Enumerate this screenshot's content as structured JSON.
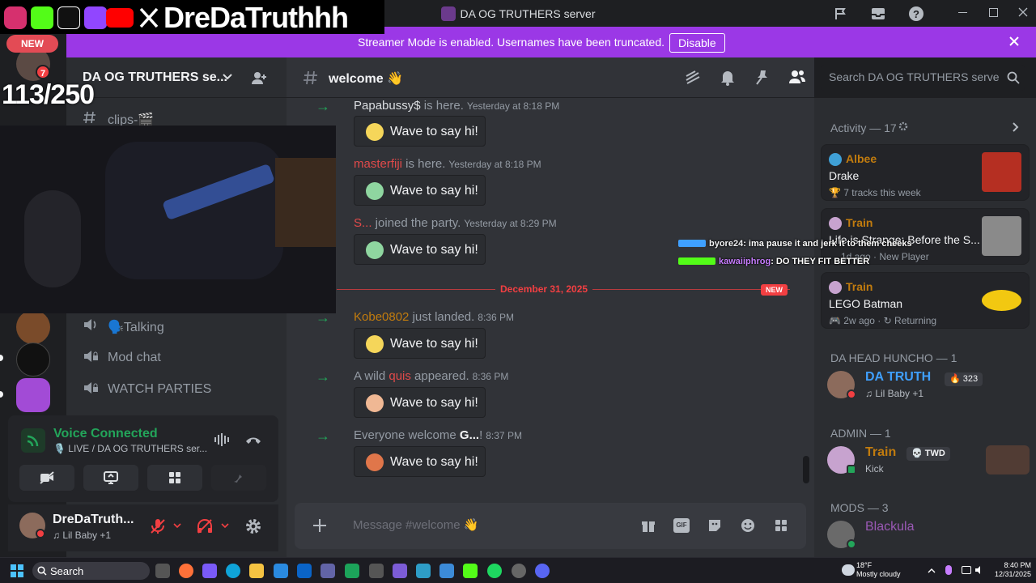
{
  "app": {
    "title": "DA OG TRUTHERS server"
  },
  "overlay": {
    "handle": "DreDaTruthhh",
    "new_badge": "NEW",
    "sub_count": "113/250",
    "rail_badge": "7"
  },
  "banner": {
    "text": "Streamer Mode is enabled. Usernames have been truncated.",
    "disable_label": "Disable"
  },
  "sidebar": {
    "server_name": "DA OG TRUTHERS se...",
    "channels": [
      {
        "label": "clips-🎬",
        "icon": "hash-icon"
      },
      {
        "label": "🗣️Talking",
        "icon": "speaker-icon"
      },
      {
        "label": "Mod chat",
        "icon": "lock-speaker-icon"
      },
      {
        "label": "WATCH PARTIES",
        "icon": "lock-speaker-icon"
      }
    ]
  },
  "voice": {
    "status": "Voice Connected",
    "detail": "🎙️ LIVE / DA OG TRUTHERS ser..."
  },
  "user": {
    "name": "DreDaTruth...",
    "status": "♫ Lil Baby +1"
  },
  "chat": {
    "channel": "welcome 👋",
    "search_placeholder": "Search DA OG TRUTHERS server",
    "composer_placeholder": "Message #welcome 👋",
    "wave_label": "Wave to say hi!",
    "date_divider": "December 31, 2025",
    "new_tag": "NEW",
    "messages": [
      {
        "name": "Papabussy$",
        "name_color": "#dbdee1",
        "text": " is here.",
        "time": "Yesterday at 8:18 PM"
      },
      {
        "name": "masterfiji",
        "name_color": "#e04a4a",
        "text": " is here.",
        "time": "Yesterday at 8:18 PM"
      },
      {
        "name": "S...",
        "name_color": "#e04a4a",
        "text": " joined the party.",
        "time": "Yesterday at 8:29 PM"
      },
      {
        "name": "Kobe0802",
        "name_color": "#c27c0e",
        "text": " just landed.",
        "time": "8:36 PM"
      },
      {
        "prefix": "A wild ",
        "name": "quis",
        "name_color": "#e04a4a",
        "text": " appeared.",
        "time": "8:36 PM"
      },
      {
        "prefix": "Everyone welcome ",
        "name": "G...",
        "name_color": "#f2f3f5",
        "text": "!",
        "time": "8:37 PM"
      }
    ]
  },
  "activity": {
    "title": "Activity — 17",
    "cards": [
      {
        "who": "Albee",
        "what": "Drake",
        "sub": "🏆 7 tracks this week"
      },
      {
        "who": "Train",
        "what": "Life is Strange: Before the S...",
        "sub": "1d ago · New Player"
      },
      {
        "who": "Train",
        "what": "LEGO Batman",
        "sub": "🎮 2w ago · ↻ Returning"
      }
    ]
  },
  "members": {
    "huncho_title": "DA HEAD HUNCHO — 1",
    "huncho": {
      "name": "DA TRUTH",
      "status": "♫ Lil Baby +1",
      "badge": "🔥 323"
    },
    "admin_title": "ADMIN — 1",
    "admin": {
      "name": "Train",
      "status": "Kick",
      "tag": "💀 TWD"
    },
    "mods_title": "MODS — 3",
    "mod": {
      "name": "Blackula"
    }
  },
  "float_chat": [
    {
      "user": "byore24",
      "msg": ": ima pause it and jerk it to them cheeks",
      "color": "#f2f3f5"
    },
    {
      "user": "kawaiiphrog",
      "msg": ": DO THEY FIT BETTER",
      "color": "#c77dff"
    }
  ],
  "taskbar": {
    "search_label": "Search",
    "weather_temp": "18°F",
    "weather_desc": "Mostly cloudy",
    "time": "8:40 PM",
    "date": "12/31/2025"
  },
  "colors": {
    "accent": "#5865f2",
    "banner": "#9b38e6",
    "green": "#23a55a",
    "red": "#f23f42"
  }
}
